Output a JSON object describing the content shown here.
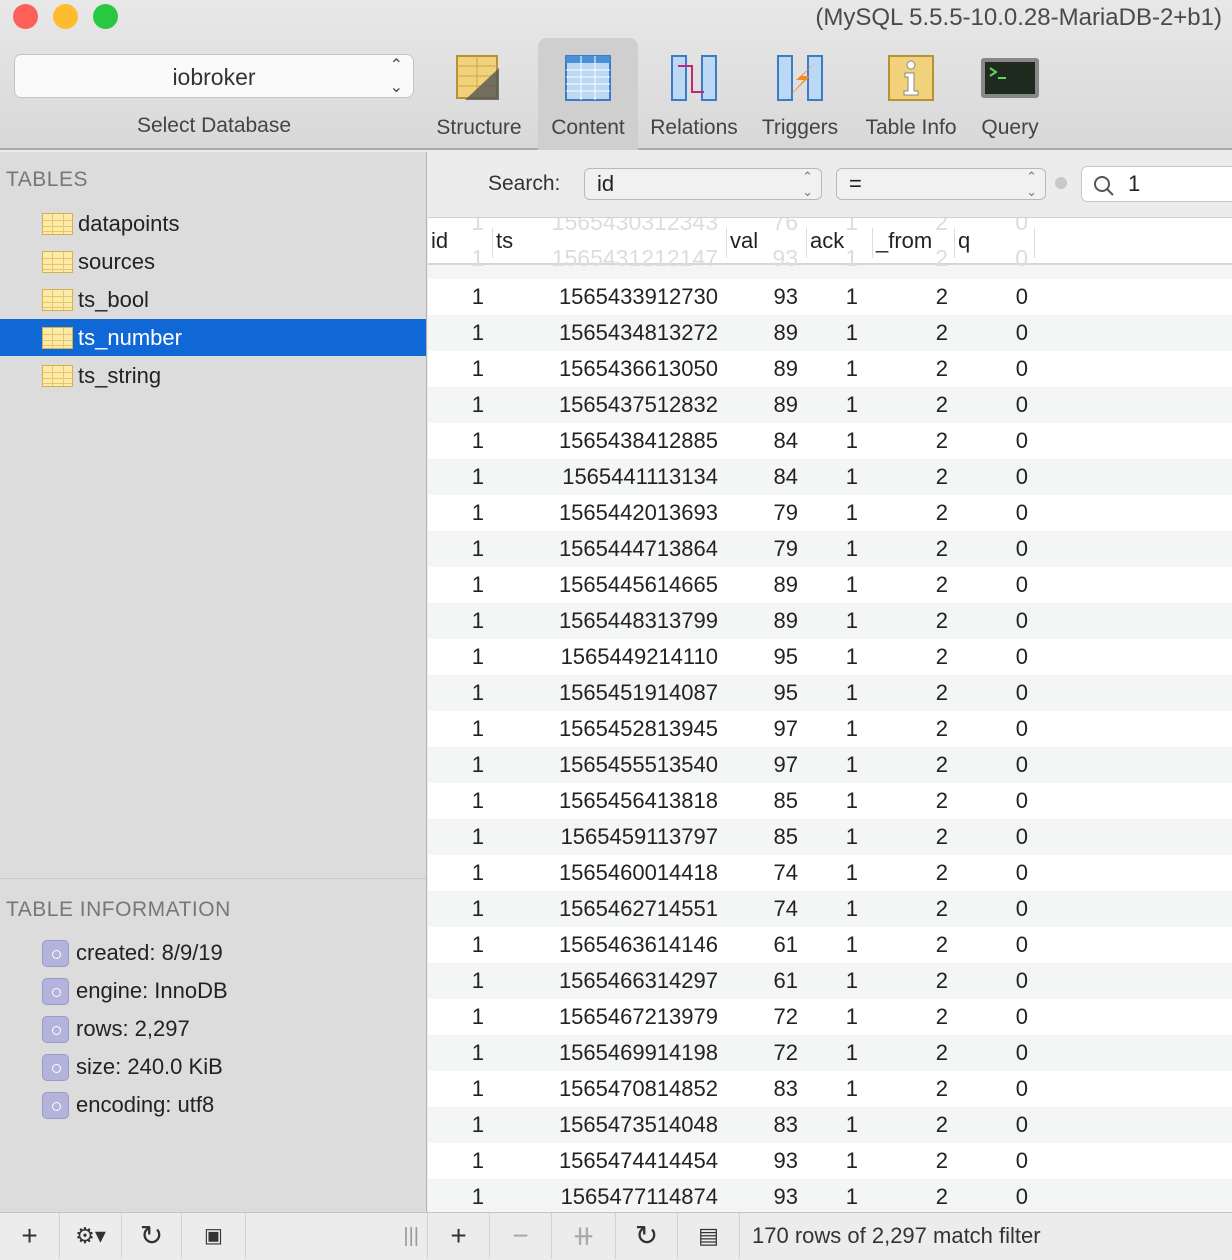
{
  "window": {
    "title": "(MySQL 5.5.5-10.0.28-MariaDB-2+b1)"
  },
  "database": {
    "selected": "iobroker",
    "label": "Select Database"
  },
  "toolbar": [
    {
      "label": "Structure",
      "icon": "structure-icon"
    },
    {
      "label": "Content",
      "icon": "content-icon",
      "active": true
    },
    {
      "label": "Relations",
      "icon": "relations-icon"
    },
    {
      "label": "Triggers",
      "icon": "triggers-icon"
    },
    {
      "label": "Table Info",
      "icon": "table-info-icon"
    },
    {
      "label": "Query",
      "icon": "query-icon"
    }
  ],
  "sidebar": {
    "tables_heading": "TABLES",
    "tables": [
      "datapoints",
      "sources",
      "ts_bool",
      "ts_number",
      "ts_string"
    ],
    "selected_table": "ts_number",
    "info_heading": "TABLE INFORMATION",
    "info": [
      "created: 8/9/19",
      "engine: InnoDB",
      "rows: 2,297",
      "size: 240.0 KiB",
      "encoding: utf8"
    ]
  },
  "search": {
    "label": "Search:",
    "field": "id",
    "operator": "=",
    "value": "1"
  },
  "columns": [
    "id",
    "ts",
    "val",
    "ack",
    "_from",
    "q"
  ],
  "ghost_rows": [
    [
      "1",
      "1565430312343",
      "76",
      "1",
      "2",
      "0"
    ],
    [
      "1",
      "1565431212147",
      "93",
      "1",
      "2",
      "0"
    ]
  ],
  "rows": [
    [
      "1",
      "1565433912730",
      "93",
      "1",
      "2",
      "0"
    ],
    [
      "1",
      "1565434813272",
      "89",
      "1",
      "2",
      "0"
    ],
    [
      "1",
      "1565436613050",
      "89",
      "1",
      "2",
      "0"
    ],
    [
      "1",
      "1565437512832",
      "89",
      "1",
      "2",
      "0"
    ],
    [
      "1",
      "1565438412885",
      "84",
      "1",
      "2",
      "0"
    ],
    [
      "1",
      "1565441113134",
      "84",
      "1",
      "2",
      "0"
    ],
    [
      "1",
      "1565442013693",
      "79",
      "1",
      "2",
      "0"
    ],
    [
      "1",
      "1565444713864",
      "79",
      "1",
      "2",
      "0"
    ],
    [
      "1",
      "1565445614665",
      "89",
      "1",
      "2",
      "0"
    ],
    [
      "1",
      "1565448313799",
      "89",
      "1",
      "2",
      "0"
    ],
    [
      "1",
      "1565449214110",
      "95",
      "1",
      "2",
      "0"
    ],
    [
      "1",
      "1565451914087",
      "95",
      "1",
      "2",
      "0"
    ],
    [
      "1",
      "1565452813945",
      "97",
      "1",
      "2",
      "0"
    ],
    [
      "1",
      "1565455513540",
      "97",
      "1",
      "2",
      "0"
    ],
    [
      "1",
      "1565456413818",
      "85",
      "1",
      "2",
      "0"
    ],
    [
      "1",
      "1565459113797",
      "85",
      "1",
      "2",
      "0"
    ],
    [
      "1",
      "1565460014418",
      "74",
      "1",
      "2",
      "0"
    ],
    [
      "1",
      "1565462714551",
      "74",
      "1",
      "2",
      "0"
    ],
    [
      "1",
      "1565463614146",
      "61",
      "1",
      "2",
      "0"
    ],
    [
      "1",
      "1565466314297",
      "61",
      "1",
      "2",
      "0"
    ],
    [
      "1",
      "1565467213979",
      "72",
      "1",
      "2",
      "0"
    ],
    [
      "1",
      "1565469914198",
      "72",
      "1",
      "2",
      "0"
    ],
    [
      "1",
      "1565470814852",
      "83",
      "1",
      "2",
      "0"
    ],
    [
      "1",
      "1565473514048",
      "83",
      "1",
      "2",
      "0"
    ],
    [
      "1",
      "1565474414454",
      "93",
      "1",
      "2",
      "0"
    ],
    [
      "1",
      "1565477114874",
      "93",
      "1",
      "2",
      "0"
    ]
  ],
  "status": "170 rows of 2,297 match filter",
  "colors": {
    "selection": "#1067d6"
  }
}
